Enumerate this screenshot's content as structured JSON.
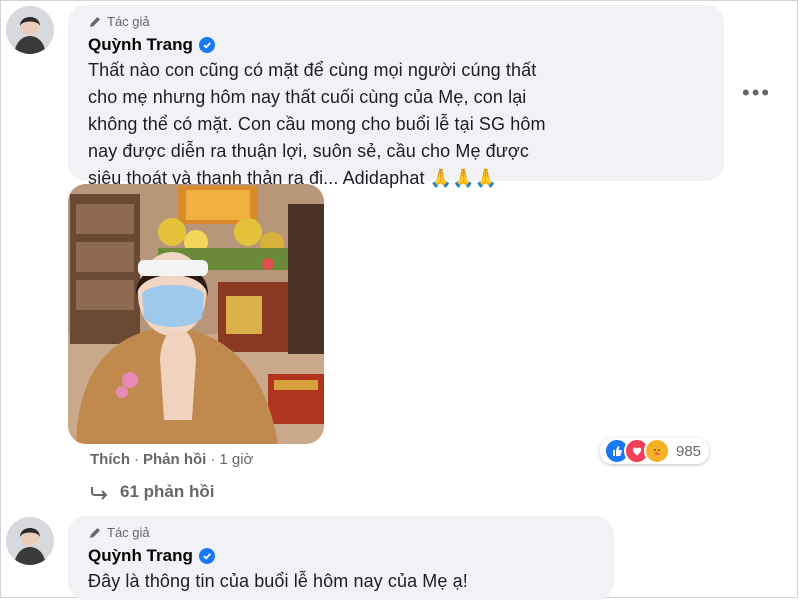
{
  "comment1": {
    "role_label": "Tác giả",
    "author": "Quỳnh Trang",
    "lines": [
      "Thất nào con cũng có mặt để cùng mọi người cúng thất",
      "cho mẹ nhưng hôm nay thất cuối cùng của Mẹ, con lại",
      "không thể có mặt. Con cầu mong cho buổi lễ tại SG hôm",
      "nay được diễn ra thuận lợi, suôn sẻ, cầu cho Mẹ được",
      "siêu thoát và thanh thản ra đi... Adidaphat 🙏🙏🙏"
    ],
    "more_label": "•••",
    "actions": {
      "like": "Thích",
      "reply": "Phản hồi",
      "time": "1 giờ"
    },
    "reactions": {
      "count": "985",
      "icons": [
        "like-reaction-icon",
        "love-reaction-icon",
        "care-reaction-icon"
      ]
    },
    "replies_label": "61 phản hồi"
  },
  "comment2": {
    "role_label": "Tác giả",
    "author": "Quỳnh Trang",
    "text": "Đây là thông tin của buổi lễ hôm nay của Mẹ ạ!"
  },
  "colors": {
    "bubble": "#f0f2f5",
    "verified": "#1877f2",
    "secondary_text": "#65676b"
  }
}
